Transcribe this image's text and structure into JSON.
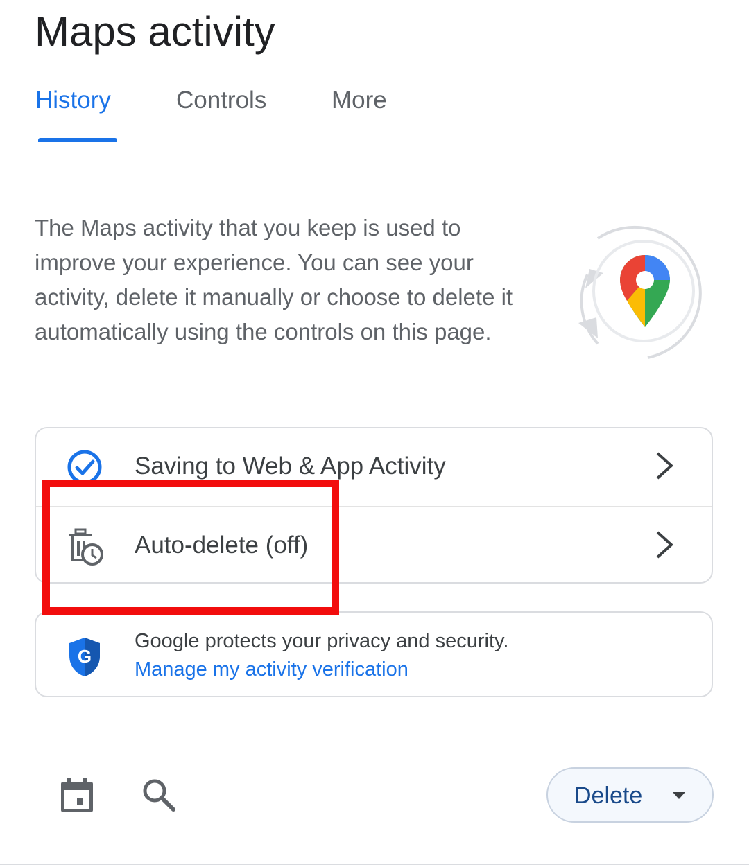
{
  "page": {
    "title": "Maps activity"
  },
  "tabs": [
    {
      "label": "History",
      "active": true
    },
    {
      "label": "Controls",
      "active": false
    },
    {
      "label": "More",
      "active": false
    }
  ],
  "intro": {
    "text": "The Maps activity that you keep is used to improve your experience. You can see your activity, delete it manually or choose to delete it automatically using the controls on this page.",
    "illustration_icon": "maps-pin-refresh-icon"
  },
  "settings": [
    {
      "label": "Saving to Web & App Activity",
      "icon": "check-circle-icon"
    },
    {
      "label": "Auto-delete (off)",
      "icon": "auto-delete-icon"
    }
  ],
  "privacy": {
    "text": "Google protects your privacy and security.",
    "link": "Manage my activity verification",
    "icon": "google-shield-icon"
  },
  "toolbar": {
    "calendar_icon": "calendar-icon",
    "search_icon": "search-icon",
    "delete_label": "Delete"
  },
  "colors": {
    "accent": "#1a73e8",
    "highlight": "#f20d0d",
    "text_secondary": "#5f6368"
  }
}
